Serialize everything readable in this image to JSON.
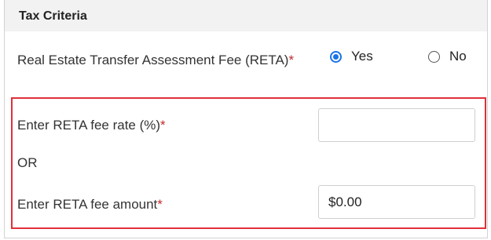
{
  "section": {
    "title": "Tax Criteria"
  },
  "reta": {
    "label": "Real Estate Transfer Assessment Fee (RETA)",
    "required_marker": "*",
    "options": {
      "yes": "Yes",
      "no": "No"
    },
    "selected": "Yes"
  },
  "fee_rate": {
    "label": "Enter RETA fee rate (%)",
    "required_marker": "*",
    "value": ""
  },
  "separator": "OR",
  "fee_amount": {
    "label": "Enter RETA fee amount",
    "required_marker": "*",
    "value": "$0.00"
  },
  "colors": {
    "header_bg": "#f2f2f2",
    "highlight_border": "#e0303b",
    "required": "#c62828",
    "radio_accent": "#1a73e8"
  }
}
